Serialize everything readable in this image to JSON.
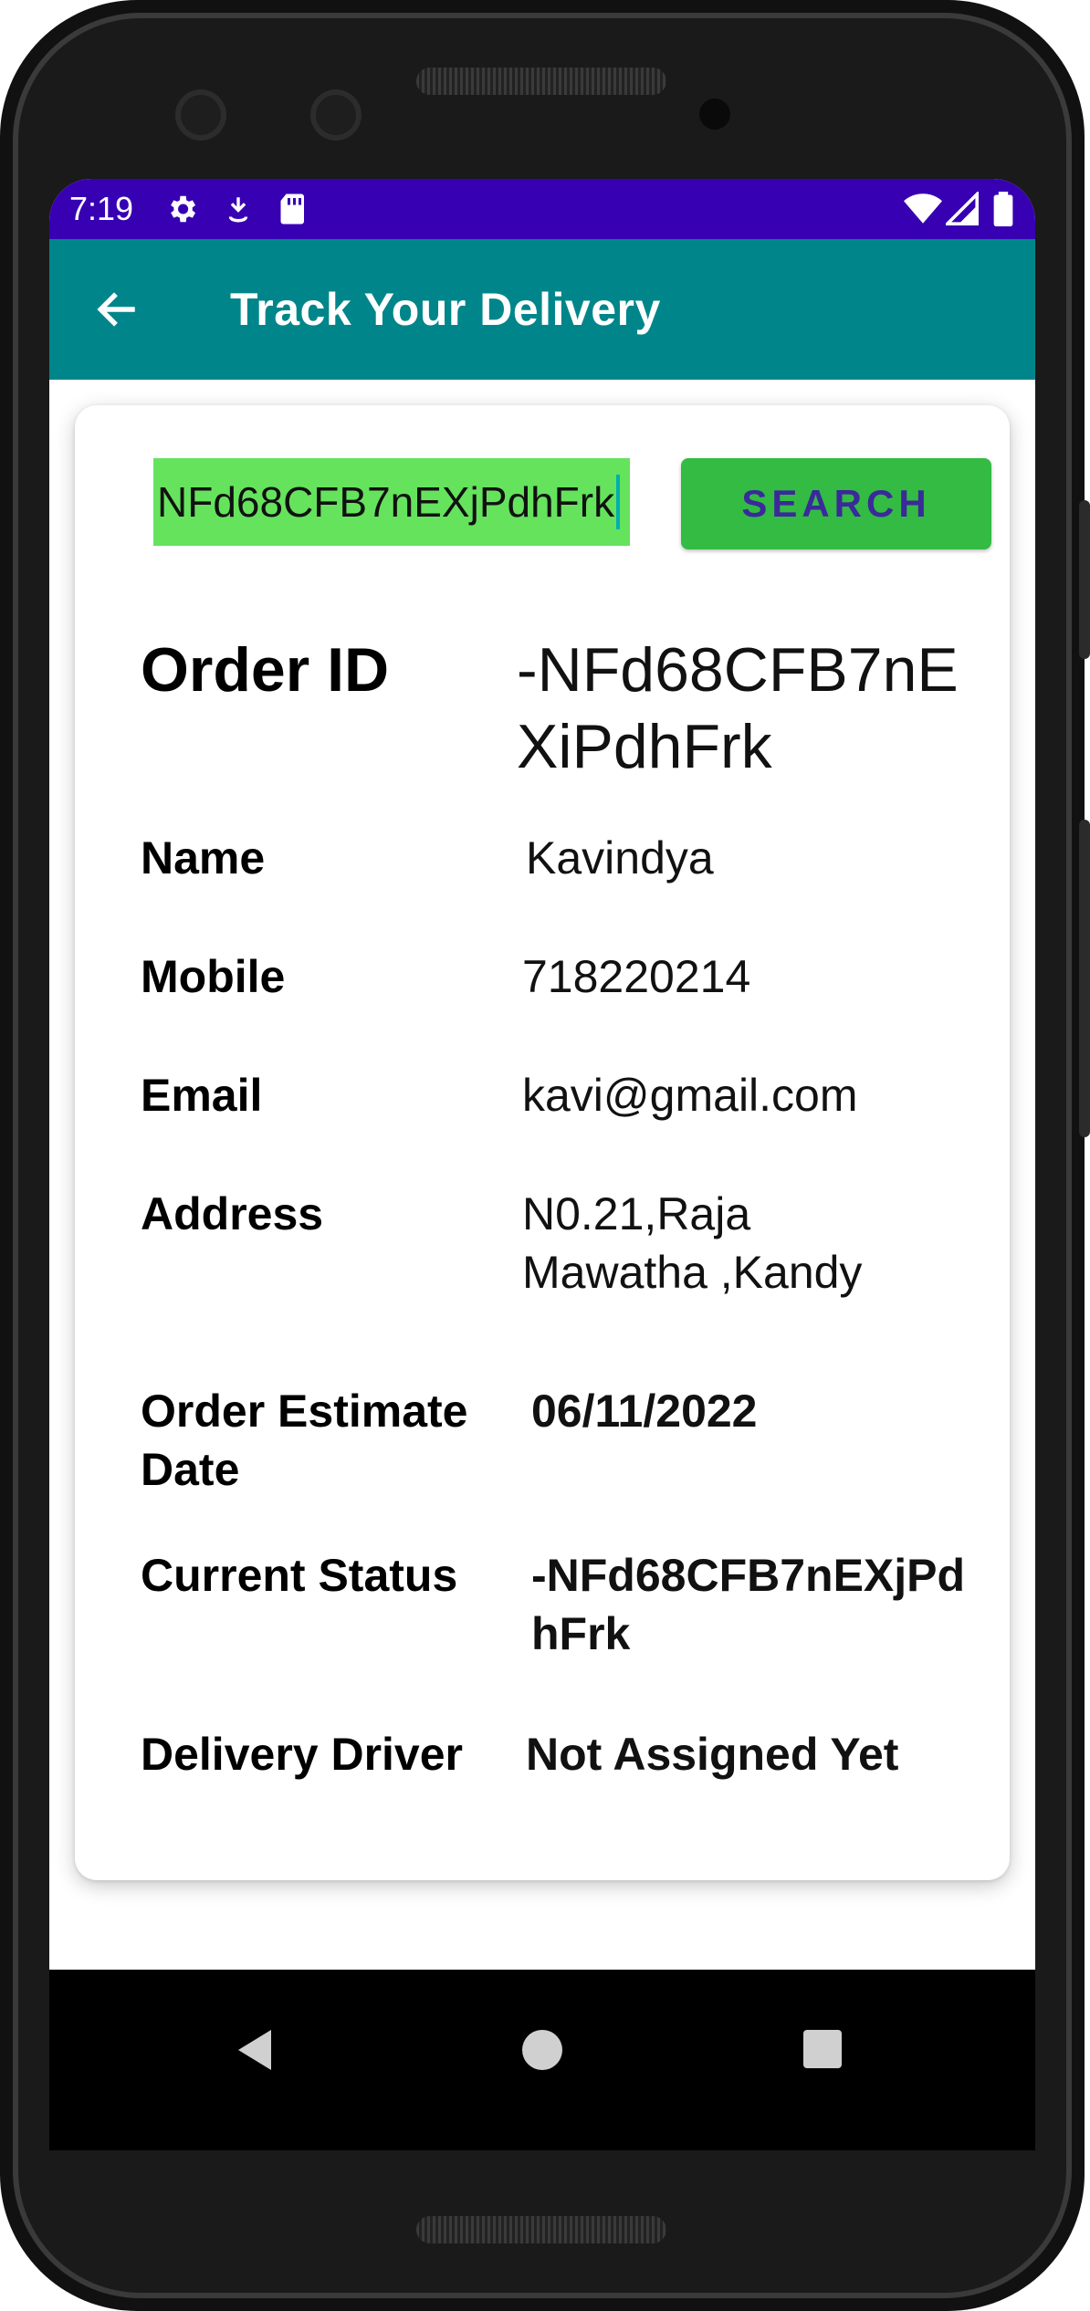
{
  "status_bar": {
    "time": "7:19",
    "left_icons": [
      "gear-icon",
      "download-icon",
      "sd-card-icon"
    ],
    "right_icons": [
      "wifi-icon",
      "signal-icon",
      "battery-icon"
    ]
  },
  "app_bar": {
    "back_icon": "arrow-left-icon",
    "title": "Track Your Delivery",
    "color": "#00868a"
  },
  "search": {
    "value": "NFd68CFB7nEXjPdhFrk",
    "button_label": "SEARCH"
  },
  "details": {
    "order_id_label": "Order ID",
    "order_id_value_line1": "-NFd68CFB7nE",
    "order_id_value_line2": "XiPdhFrk",
    "name_label": "Name",
    "name_value": "Kavindya",
    "mobile_label": "Mobile",
    "mobile_value": "718220214",
    "email_label": "Email",
    "email_value": "kavi@gmail.com",
    "address_label": "Address",
    "address_value_line1": "N0.21,Raja",
    "address_value_line2": "Mawatha ,Kandy",
    "estimate_label_line1": "Order Estimate",
    "estimate_label_line2": "Date",
    "estimate_value": "06/11/2022",
    "status_label": "Current Status",
    "status_value_line1": "-NFd68CFB7nEXjPd",
    "status_value_line2": "hFrk",
    "driver_label": "Delivery Driver",
    "driver_value": "Not Assigned Yet"
  },
  "nav_bar": {
    "icons": [
      "back-triangle-icon",
      "home-circle-icon",
      "recents-square-icon"
    ]
  },
  "colors": {
    "status_bar": "#3700b3",
    "search_input_bg": "#65e35d",
    "search_button_bg": "#33bb44",
    "search_button_text": "#3a2a9a"
  }
}
